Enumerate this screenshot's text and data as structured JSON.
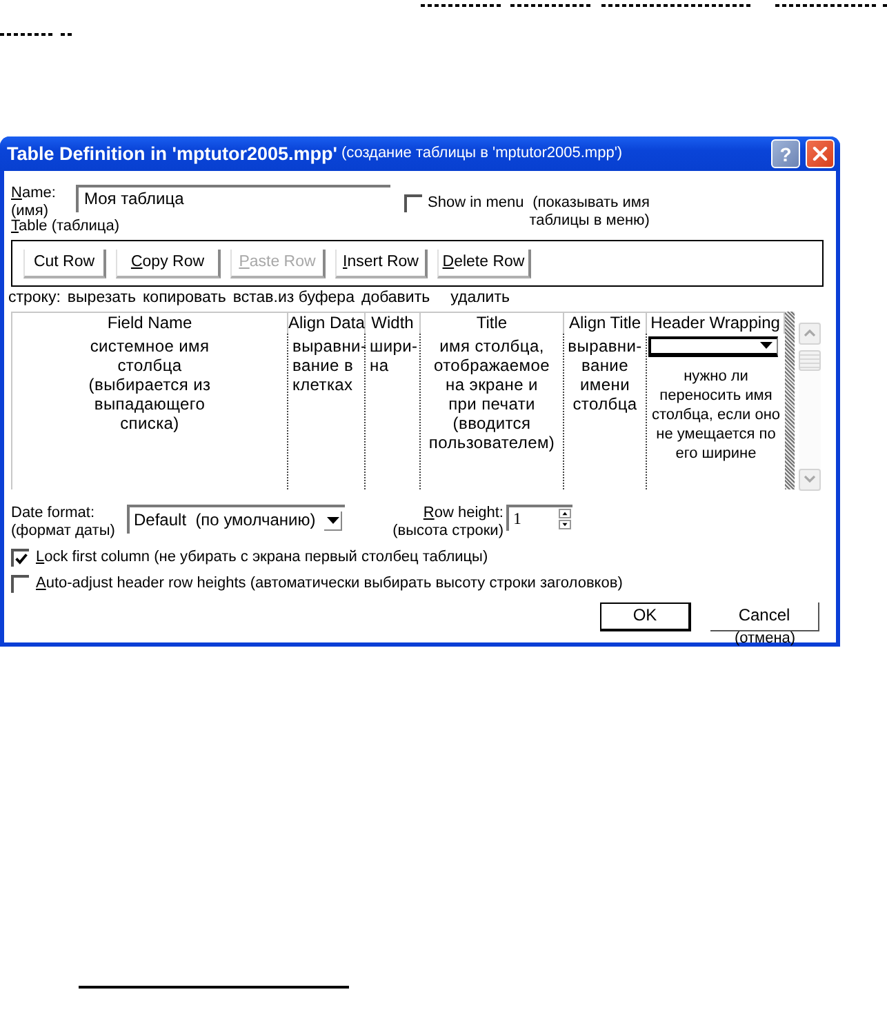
{
  "window": {
    "title": "Table Definition in 'mptutor2005.mpp'",
    "title_note": "(создание таблицы в 'mptutor2005.mpp')",
    "help_button": "?"
  },
  "name_field": {
    "label": "Name:",
    "label_note": "(имя)",
    "value": "Моя таблица"
  },
  "show_in_menu": {
    "label": "Show in menu",
    "note": "(показывать имя\nтаблицы в меню)",
    "checked": false
  },
  "table_label": "Table (таблица)",
  "toolbar": {
    "buttons": [
      {
        "label": "Cut Row",
        "disabled": false
      },
      {
        "label": "Copy Row",
        "disabled": false
      },
      {
        "label": "Paste Row",
        "disabled": true
      },
      {
        "label": "Insert Row",
        "disabled": false
      },
      {
        "label": "Delete Row",
        "disabled": false
      }
    ],
    "captions": [
      "строку:",
      "вырезать",
      "копировать",
      "встав.из буфера",
      "добавить",
      "удалить"
    ]
  },
  "grid": {
    "columns": [
      "Field Name",
      "Align Data",
      "Width",
      "Title",
      "Align Title",
      "Header Wrapping"
    ],
    "rows": [
      {
        "cells": [
          {
            "kind": "text",
            "text": "системное имя\nстолбца\n(выбирается из\nвыпадающего\nсписка)"
          },
          {
            "kind": "text",
            "text": "выравни-\nвание в\nклетках"
          },
          {
            "kind": "text",
            "text": "шири-\nна"
          },
          {
            "kind": "text",
            "text": "имя столбца,\nотображаемое\nна экране и\nпри печати\n(вводится\nпользователем)"
          },
          {
            "kind": "text",
            "text": "выравни-\nвание\nимени\nстолбца"
          },
          {
            "kind": "dropdown",
            "note": "нужно ли\nпереносить имя\nстолбца, если оно\nне умещается по\nего ширине"
          }
        ]
      }
    ]
  },
  "date_format": {
    "label": "Date format:",
    "note": "(формат даты)",
    "value": "Default  (по умолчанию)"
  },
  "row_height": {
    "label": "Row height:",
    "note": "(высота строки)",
    "value": "1"
  },
  "options": [
    {
      "label": "Lock first column (не убирать с экрана первый столбец таблицы)",
      "checked": true
    },
    {
      "label": "Auto-adjust header row heights (автоматически выбирать высоту строки заголовков)",
      "checked": false
    }
  ],
  "buttons": [
    {
      "label": "OK",
      "default": true
    },
    {
      "label": "Cancel",
      "default": false,
      "note": "(отмена)"
    }
  ]
}
